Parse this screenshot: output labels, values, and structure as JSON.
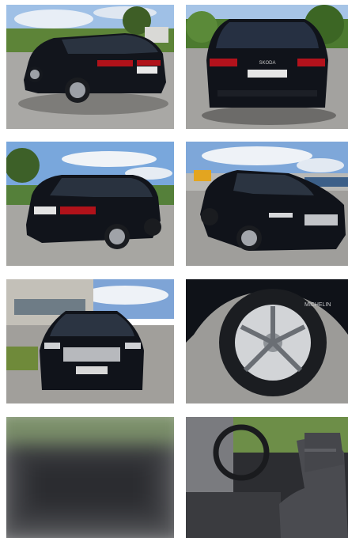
{
  "gallery": {
    "photos": [
      {
        "subject": "rear-three-quarter-left",
        "icon": "car-photo",
        "plate_text": ""
      },
      {
        "subject": "rear-view",
        "icon": "car-photo",
        "badge_text": "SKODA"
      },
      {
        "subject": "rear-three-quarter-left-field",
        "icon": "car-photo"
      },
      {
        "subject": "front-three-quarter-right",
        "icon": "car-photo"
      },
      {
        "subject": "front-view",
        "icon": "car-photo"
      },
      {
        "subject": "wheel-closeup",
        "icon": "wheel-photo",
        "tyre_text": "MICHELIN"
      },
      {
        "subject": "blurred-image",
        "icon": "blurred-photo"
      },
      {
        "subject": "interior-driver-seat",
        "icon": "interior-photo"
      }
    ]
  },
  "colors": {
    "car_body": "#12151c",
    "sky": "#7fa8d8",
    "asphalt": "#a4a4a2",
    "grass": "#5f8a3c"
  }
}
